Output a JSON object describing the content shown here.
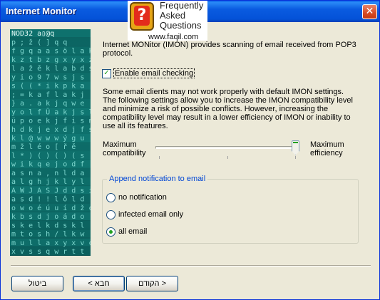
{
  "window": {
    "title": "Internet Monitor",
    "close_glyph": "✕"
  },
  "watermark": {
    "badge_glyph": "?",
    "line1": "Frequently",
    "line2": "Asked",
    "line3": "Questions",
    "url": "www.faqil.com"
  },
  "side_panel": {
    "rows": [
      "NOD32 a▯@q",
      "p ; ž ( ]  q q",
      "f g q a a s ö l a k",
      "k z t b z g x y x z",
      "l a ž ě k l a b d s",
      "y i o 9 7 w s j s",
      "s ( ( * i k p k a",
      "  ; = k a f l a k j",
      "} a . a k j q w e",
      "y o l f Ü a k j s l",
      "ü p o e k j f i s n",
      "h d k j e x d j f s",
      "  k l @ w w w ý g u",
      "m ž  l é  o [ ř ě",
      "l * ) ( ) ( ) ( s",
      "w i k q e j o d f",
      "a s n a , n l d a",
      "a l g h j k l y l",
      "A W J A S J d d s í",
      "a s d ! ! l ô l d",
      "o w o é ú u í d ž c",
      "k b s d j o á d o",
      "s k e l k d s k l",
      "m t o s h / l k w",
      "m u l l a x y x v c",
      "x v s s q w r t t"
    ]
  },
  "intro_text": "Internet MONitor (IMON) provides scanning of email received from POP3 protocol.",
  "enable_checkbox": {
    "label": "Enable email checking",
    "checked": true,
    "check_glyph": "✓"
  },
  "warning_text": "Some email clients may not work properly with default IMON settings. The following settings allow you to increase the IMON compatibility level and minimize a risk of possible conflicts. However, increasing the compatibility level may result in a lower efficiency of IMON or inability to use all its features.",
  "slider": {
    "left_label": "Maximum compatibility",
    "right_label": "Maximum efficiency",
    "position_fraction": 1.0
  },
  "notification_group": {
    "title": "Append notification to email",
    "options": [
      {
        "label": "no notification",
        "selected": false
      },
      {
        "label": "infected email only",
        "selected": false
      },
      {
        "label": "all email",
        "selected": true
      }
    ]
  },
  "buttons": {
    "cancel": "ביטול",
    "back": "< חבא",
    "next": "הקודם >"
  },
  "colors": {
    "titlebar": "#0A5BE0",
    "group_title": "#0046D5",
    "check_green": "#21A121",
    "panel_teal": "#0E6F6B"
  }
}
